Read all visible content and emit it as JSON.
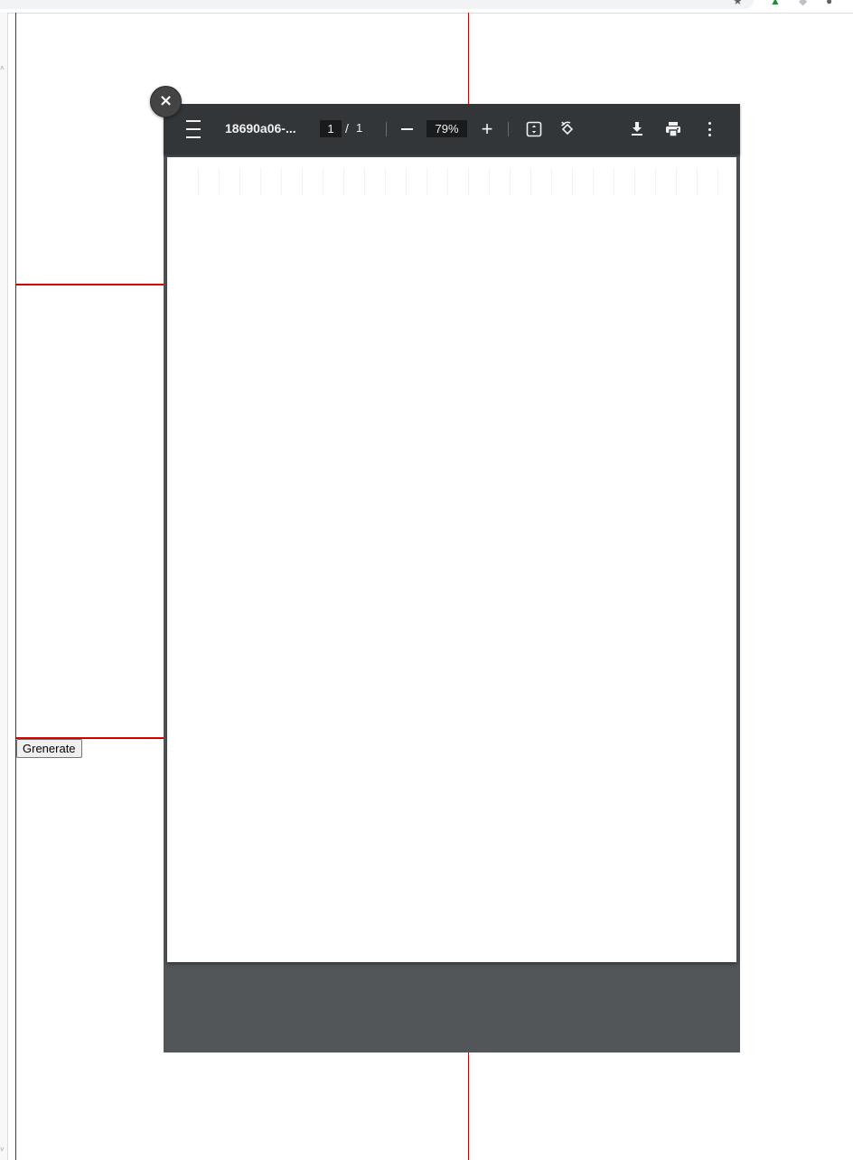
{
  "browser": {
    "icons": [
      "star-icon",
      "extension-icon",
      "account-icon"
    ]
  },
  "page": {
    "generate_label": "Grenerate"
  },
  "viewer": {
    "close_label": "×",
    "document_title": "18690a06-...",
    "current_page": "1",
    "page_separator": "/",
    "total_pages": "1",
    "zoom_level": "79%",
    "zoom_in_label": "+"
  },
  "colors": {
    "toolbar_bg": "#323639",
    "viewer_bg": "#525659",
    "guide_line": "#d40000"
  }
}
